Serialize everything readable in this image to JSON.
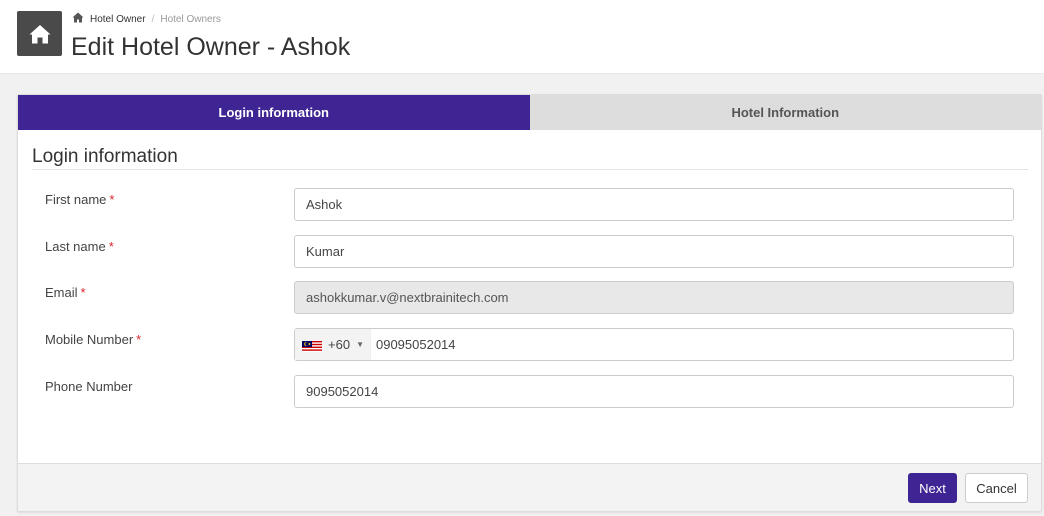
{
  "breadcrumb": {
    "home_icon": "home-icon",
    "link": "Hotel Owner",
    "separator": "/",
    "current": "Hotel Owners"
  },
  "page": {
    "title": "Edit Hotel Owner - Ashok",
    "icon": "home-icon"
  },
  "tabs": [
    {
      "label": "Login information",
      "active": true
    },
    {
      "label": "Hotel Information",
      "active": false
    }
  ],
  "section": {
    "title": "Login information"
  },
  "form": {
    "required_marker": "*",
    "first_name": {
      "label": "First name",
      "value": "Ashok"
    },
    "last_name": {
      "label": "Last name",
      "value": "Kumar"
    },
    "email": {
      "label": "Email",
      "value": "ashokkumar.v@nextbrainitech.com"
    },
    "mobile": {
      "label": "Mobile Number",
      "dial_code": "+60",
      "value": "09095052014",
      "flag_icon": "malaysia-flag-icon"
    },
    "phone": {
      "label": "Phone Number",
      "value": "9095052014"
    }
  },
  "actions": {
    "next": "Next",
    "cancel": "Cancel"
  },
  "colors": {
    "accent": "#3f2593",
    "required": "#d9232d"
  }
}
